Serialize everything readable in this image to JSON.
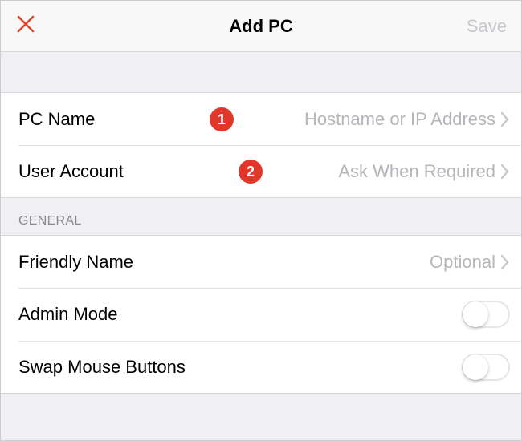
{
  "navbar": {
    "title": "Add PC",
    "save_label": "Save"
  },
  "group1": {
    "rows": [
      {
        "label": "PC Name",
        "value": "Hostname or IP Address"
      },
      {
        "label": "User Account",
        "value": "Ask When Required"
      }
    ]
  },
  "group2": {
    "header": "GENERAL",
    "rows": [
      {
        "label": "Friendly Name",
        "value": "Optional"
      },
      {
        "label": "Admin Mode"
      },
      {
        "label": "Swap Mouse Buttons"
      }
    ]
  },
  "annotations": {
    "badge1": "1",
    "badge2": "2"
  }
}
